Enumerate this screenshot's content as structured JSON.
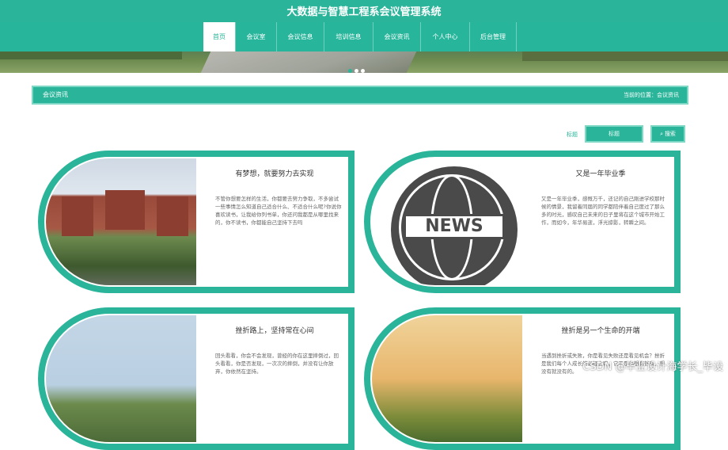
{
  "header": {
    "title": "大数据与智慧工程系会议管理系统"
  },
  "nav": {
    "items": [
      {
        "label": "首页",
        "active": true
      },
      {
        "label": "会议室",
        "active": false
      },
      {
        "label": "会议信息",
        "active": false
      },
      {
        "label": "培训信息",
        "active": false
      },
      {
        "label": "会议资讯",
        "active": false
      },
      {
        "label": "个人中心",
        "active": false
      },
      {
        "label": "后台管理",
        "active": false
      }
    ]
  },
  "banner": {
    "slides": 3,
    "active_slide": 1
  },
  "section": {
    "title": "会议资讯",
    "breadcrumb": "当前的位置：会议资讯"
  },
  "search": {
    "label": "标题",
    "placeholder": "标题",
    "button": "搜索"
  },
  "cards": [
    {
      "title": "有梦想，就要努力去实现",
      "desc": "不管你想要怎样的生活，你都要去努力争取，不多尝试一些事情怎么知道自己适合什么、不适合什么呢?你说你喜欢读书，让我给你列书单，你还问我都是从哪里找来的，你不读书，你都能自己坚持下去吗"
    },
    {
      "title": "又是一年毕业季",
      "desc": "又是一年毕业季，感慨万千，还记的自己刚进学校那时候的情景，我留着同届的同学都陪伴着自己度过了那么多的时光，感叹自己未来的日子里将在这个城市开始工作，而如今，年华易逝，浮光掠影，转瞬之间。"
    },
    {
      "title": "挫折路上，坚持常在心间",
      "desc": "回头看看，你会不会发现，曾经的你在这里摔倒过，回头看看，你是否发现，一次次的摔倒，并没有让你放弃，你依然在坚持。"
    },
    {
      "title": "挫折是另一个生命的开端",
      "desc": "当遇到挫折或失败，你是看见失败还是看见机会？挫折是我们每个人成长的必经之路，它不是你想有就有，想没有就没有的。"
    }
  ],
  "watermark": "CSDN @毕业设计海学长_毕设"
}
